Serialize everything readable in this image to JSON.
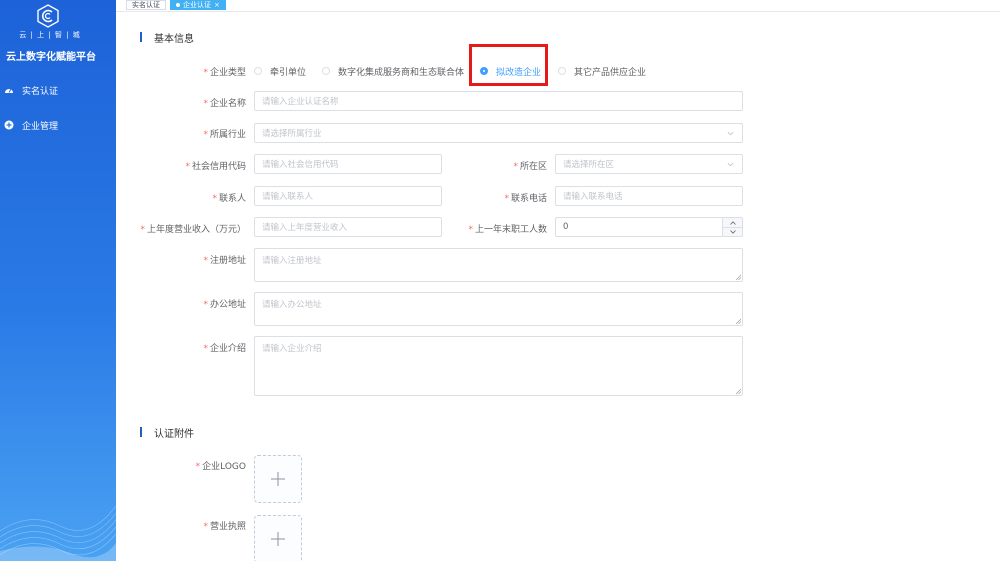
{
  "sidebar": {
    "logo_sub": "云 | 上 | 智 | 城",
    "platform_title": "云上数字化赋能平台",
    "items": [
      {
        "label": "实名认证",
        "icon": "dashboard-icon"
      },
      {
        "label": "企业管理",
        "icon": "plus-circle-icon"
      }
    ]
  },
  "tabs": [
    {
      "label": "实名认证",
      "active": false
    },
    {
      "label": "企业认证",
      "active": true,
      "close": "×"
    }
  ],
  "sections": {
    "basic": "基本信息",
    "attachments": "认证附件"
  },
  "form": {
    "required_mark": "*",
    "company_type": {
      "label": "企业类型",
      "options": [
        "牵引单位",
        "数字化集成服务商和生态联合体",
        "拟改造企业",
        "其它产品供应企业"
      ],
      "selected": "拟改造企业"
    },
    "company_name": {
      "label": "企业名称",
      "placeholder": "请输入企业认证名称"
    },
    "industry": {
      "label": "所属行业",
      "placeholder": "请选择所属行业"
    },
    "credit_code": {
      "label": "社会信用代码",
      "placeholder": "请输入社会信用代码"
    },
    "district": {
      "label": "所在区",
      "placeholder": "请选择所在区"
    },
    "contact": {
      "label": "联系人",
      "placeholder": "请输入联系人"
    },
    "phone": {
      "label": "联系电话",
      "placeholder": "请输入联系电话"
    },
    "revenue": {
      "label": "上年度营业收入（万元）",
      "placeholder": "请输入上年度营业收入"
    },
    "employees": {
      "label": "上一年末职工人数",
      "value": "0"
    },
    "reg_address": {
      "label": "注册地址",
      "placeholder": "请输入注册地址"
    },
    "office_address": {
      "label": "办公地址",
      "placeholder": "请输入办公地址"
    },
    "intro": {
      "label": "企业介绍",
      "placeholder": "请输入企业介绍"
    },
    "logo": {
      "label": "企业LOGO"
    },
    "license": {
      "label": "营业执照"
    }
  },
  "colors": {
    "sidebar_start": "#1d62d8",
    "sidebar_end": "#4aa2f2",
    "accent": "#409eff",
    "required": "#f56c6c",
    "highlight": "#e41b1b"
  }
}
